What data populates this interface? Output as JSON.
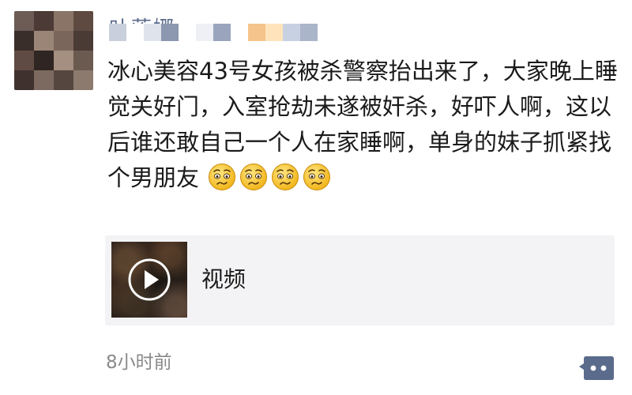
{
  "post": {
    "username": "叶莲娜",
    "text": "冰心美容43号女孩被杀警察抬出来了，大家晚上睡觉关好门，入室抢劫未遂被奸杀，好吓人啊，这以后谁还敢自己一个人在家睡啊，单身的妹子抓紧找个男朋友",
    "emoji_icon": "worried-face-icon",
    "emoji_count": 4,
    "video": {
      "label": "视频",
      "play_icon": "play-icon"
    },
    "timestamp": "8小时前",
    "comment_icon": "comment-dots-icon"
  },
  "colors": {
    "username": "#5b6b8c",
    "text": "#1a1a1a",
    "timestamp": "#8a8a8a",
    "video_card_bg": "#f3f3f5",
    "comment_button_bg": "#5b6b8c"
  }
}
